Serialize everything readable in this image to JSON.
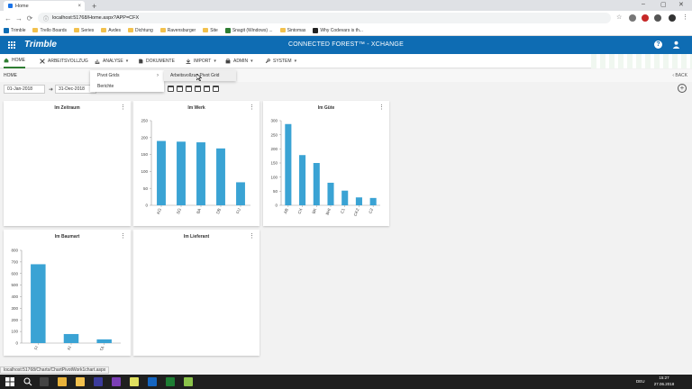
{
  "browser": {
    "tab_title": "Home",
    "tab_close": "×",
    "new_tab": "+",
    "url": "localhost:51768/Home.aspx?APP=CFX",
    "window_controls": [
      "–",
      "▢",
      "✕"
    ],
    "nav": [
      "←",
      "→",
      "⟳",
      "⌂"
    ],
    "bookmarks": [
      {
        "label": "Trimble",
        "icon": "trimble-logo"
      },
      {
        "label": "Trello Boards",
        "icon": "folder"
      },
      {
        "label": "Series",
        "icon": "folder"
      },
      {
        "label": "Avdes",
        "icon": "folder"
      },
      {
        "label": "Dichtung",
        "icon": "folder"
      },
      {
        "label": "Ravensburger",
        "icon": "folder"
      },
      {
        "label": "Site",
        "icon": "folder"
      },
      {
        "label": "Snagit (Windows) ...",
        "icon": "snagit-logo"
      },
      {
        "label": "Sintomas",
        "icon": "folder"
      },
      {
        "label": "Why Codevars is th...",
        "icon": "codevars-logo"
      }
    ]
  },
  "app": {
    "brand": "Trimble",
    "title": "CONNECTED FOREST™ - XCHANGE",
    "help": "?",
    "colors": {
      "header": "#0e6cb3",
      "bar": "#3aa3d4",
      "active_nav": "#2e7d32"
    }
  },
  "nav": {
    "items": [
      {
        "label": "HOME",
        "icon": "home-icon"
      },
      {
        "label": "ARBEITSVOLLZUG",
        "icon": "tools-icon"
      },
      {
        "label": "ANALYSE",
        "icon": "chart-icon"
      },
      {
        "label": "DOKUMENTE",
        "icon": "document-icon"
      },
      {
        "label": "IMPORT",
        "icon": "import-icon"
      },
      {
        "label": "ADMIN",
        "icon": "admin-icon"
      },
      {
        "label": "SYSTEM",
        "icon": "wrench-icon"
      }
    ],
    "caret": "▾"
  },
  "breadcrumb": {
    "current": "HOME",
    "back": "‹ BACK"
  },
  "dropdown": {
    "items": [
      "Pivot Grids",
      "Berichte"
    ],
    "arrow": "›",
    "submenu": "Arbeitsvollzug Pivot Grid"
  },
  "filters": {
    "from": "01-Jan-2018",
    "to": "31-Dec-2018",
    "arrow": "➜",
    "add": "+"
  },
  "cards": [
    {
      "title": "Im Zeitraum",
      "menu": "⋮"
    },
    {
      "title": "Im Werk",
      "menu": "⋮"
    },
    {
      "title": "Im Güte",
      "menu": "⋮"
    },
    {
      "title": "Im Baumart",
      "menu": "⋮"
    },
    {
      "title": "Im Lieferant",
      "menu": "⋮"
    }
  ],
  "chart_data": [
    {
      "type": "bar",
      "title": "Im Werk",
      "categories": [
        "KG",
        "SG",
        "BA",
        "DB",
        "FU"
      ],
      "values": [
        190,
        188,
        186,
        168,
        68
      ],
      "ylim": [
        0,
        250
      ],
      "yticks": [
        0,
        50,
        100,
        150,
        200,
        250
      ]
    },
    {
      "type": "bar",
      "title": "Im Güte",
      "categories": [
        "AB",
        "CX",
        "BK",
        "BHI",
        "C1",
        "CK2",
        "C2"
      ],
      "values": [
        288,
        178,
        150,
        80,
        52,
        28,
        26
      ],
      "ylim": [
        0,
        300
      ],
      "yticks": [
        0,
        50,
        100,
        150,
        200,
        250,
        300
      ]
    },
    {
      "type": "bar",
      "title": "Im Baumart",
      "categories": [
        "FI",
        "KI",
        "TA"
      ],
      "values": [
        680,
        78,
        32
      ],
      "ylim": [
        0,
        800
      ],
      "yticks": [
        0,
        100,
        200,
        300,
        400,
        500,
        600,
        700,
        800
      ]
    }
  ],
  "status_url": "localhost:51768/Charts/ChartPivotWork1chart.aspx",
  "taskbar": {
    "time": "15:27",
    "date": "27.06.2018",
    "lang": "DEU"
  }
}
